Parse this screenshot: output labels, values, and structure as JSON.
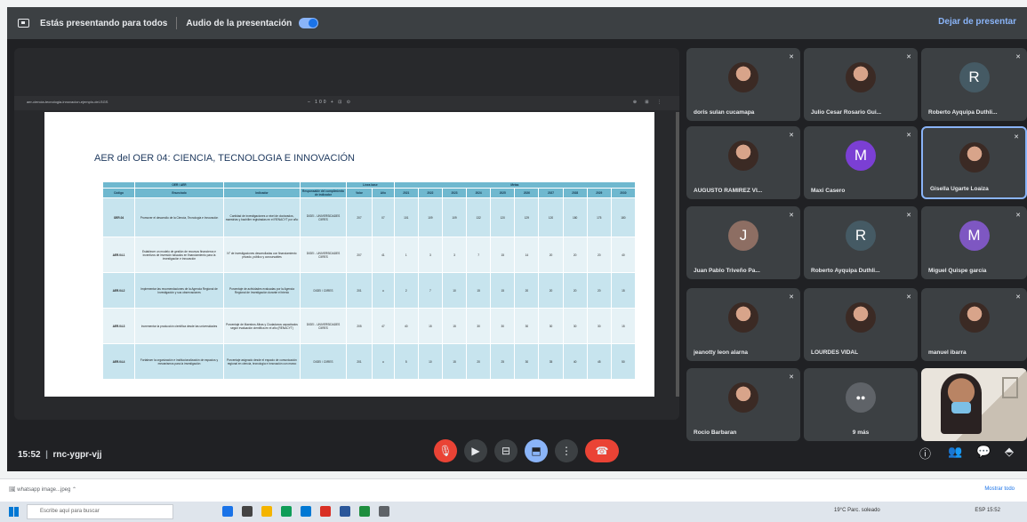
{
  "presentation_bar": {
    "status": "Estás presentando para todos",
    "audio_label": "Audio de la presentación",
    "stop_label": "Dejar de presentar"
  },
  "shared_doc": {
    "file_name": "aer-ciencia-tecnologia-innovacion-ejemplo-del-SGS",
    "zoom_controls": "– 100 + ⊡ ⊙",
    "tools": "⊕ ⊞ ⋮",
    "title": "AER del OER 04: CIENCIA, TECNOLOGIA E INNOVACIÓN",
    "header_group_aer": "OER / AER",
    "header_group_baseline": "Línea base",
    "header_group_goals": "Metas",
    "headers": [
      "Código",
      "Enunciado",
      "Indicador",
      "Responsable del cumplimiento de indicador",
      "Valor",
      "Año",
      "2021",
      "2022",
      "2023",
      "2024",
      "2025",
      "2026",
      "2027",
      "2028",
      "2029",
      "2030"
    ],
    "rows": [
      {
        "code": "OER.04",
        "statement": "Promover el desarrollo de la Ciencia, Tecnología e Innovación",
        "indicator": "Cantidad de investigaciones a nivel de doctorados, maestrías y bachiller registradas en el RENACYT por año",
        "responsible": "DIGEI - UNIVERSIDADES CIIRES",
        "values": [
          "207",
          "07",
          "101",
          "109",
          "109",
          "132",
          "120",
          "129",
          "120",
          "180",
          "175",
          "180"
        ]
      },
      {
        "code": "AER.04.1",
        "statement": "Establecer un modelo de gestión de recursos financieros e incentivos de inversión basados en financiamiento para la investigación e innovación",
        "indicator": "N° de investigaciones desarrolladas con financiamiento privado, público y concursables",
        "responsible": "DIGEI - UNIVERSIDADES CIIRES",
        "values": [
          "207",
          "41",
          "1",
          "3",
          "3",
          "7",
          "15",
          "14",
          "20",
          "20",
          "20",
          "40"
        ]
      },
      {
        "code": "AER.04.2",
        "statement": "Implementar las recomendaciones de la Agencia Regional de Investigación y sus observaciones",
        "indicator": "Porcentaje de actividades evaluadas por la Agencia Regional de Investigación durante el trienio",
        "responsible": "DIGEI / CIIRES",
        "values": [
          "201",
          "u",
          "2",
          "7",
          "10",
          "15",
          "15",
          "20",
          "20",
          "20",
          "20",
          "15"
        ]
      },
      {
        "code": "AER.04.3",
        "statement": "Incrementar la producción científica desde las universidades",
        "indicator": "Porcentaje de Maestros-Miras y Ciudadanos capacitados según evaluación científica en el año (RENACYT)",
        "responsible": "DIGEI - UNIVERSIDADES CIIRES",
        "values": [
          "205",
          "47",
          "40",
          "15",
          "15",
          "30",
          "30",
          "30",
          "30",
          "30",
          "30",
          "15"
        ]
      },
      {
        "code": "AER.04.4",
        "statement": "Fortalecer la organización e institucionalización de espacios y mecanismos para la investigación",
        "indicator": "Porcentaje asignado desde el espacio de comunicación regional en ciencia, tecnología e innovación con marco",
        "responsible": "DIGEI / CIIRES",
        "values": [
          "201",
          "u",
          "5",
          "10",
          "15",
          "20",
          "25",
          "30",
          "35",
          "40",
          "45",
          "50"
        ]
      }
    ]
  },
  "participants": [
    {
      "name": "doris sulan cucamapa",
      "avatar_letter": "",
      "avatar_color": "#7b4a3a"
    },
    {
      "name": "Julio Cesar Rosario Gui...",
      "avatar_letter": "",
      "avatar_color": "#4a7ba6"
    },
    {
      "name": "Roberto Ayquipa Duthli...",
      "avatar_letter": "R",
      "avatar_color": "#455a64"
    },
    {
      "name": "AUGUSTO RAMIREZ VI...",
      "avatar_letter": "",
      "avatar_color": "#6b4f3a"
    },
    {
      "name": "Maxi Casero",
      "avatar_letter": "M",
      "avatar_color": "#7b3fd4"
    },
    {
      "name": "Gisella Ugarte Loaiza",
      "avatar_letter": "",
      "avatar_color": "#b0473b"
    },
    {
      "name": "Juan Pablo Triveño Pa...",
      "avatar_letter": "J",
      "avatar_color": "#8d6e63"
    },
    {
      "name": "Roberto Ayquipa Duthli...",
      "avatar_letter": "R",
      "avatar_color": "#455a64"
    },
    {
      "name": "Miguel Quispe garcia",
      "avatar_letter": "M",
      "avatar_color": "#7e57c2"
    },
    {
      "name": "jeanotty leon alarna",
      "avatar_letter": "",
      "avatar_color": "#c0504d"
    },
    {
      "name": "LOURDES VIDAL",
      "avatar_letter": "",
      "avatar_color": "#d35400"
    },
    {
      "name": "manuel ibarra",
      "avatar_letter": "",
      "avatar_color": "#a04030"
    },
    {
      "name": "Rocio Barbaran",
      "avatar_letter": "",
      "avatar_color": "#5d8aa8"
    }
  ],
  "others_tile": {
    "label": "9 más"
  },
  "meeting": {
    "time": "15:52",
    "code": "rnc-ygpr-vjj"
  },
  "controls": {
    "mic": "🎙",
    "camera": "▶",
    "captions": "⊟",
    "present": "⬒",
    "more": "⋮",
    "leave": "☎"
  },
  "right_controls": {
    "info": "ⓘ",
    "people": "👥",
    "chat": "💬",
    "activities": "⬘"
  },
  "downloads": {
    "file": "whatsapp image...jpeg",
    "show_all": "Mostrar todo"
  },
  "taskbar": {
    "search_placeholder": "Escribe aquí para buscar",
    "weather": "19°C  Parc. soleado",
    "tray": "ESP  15:52"
  },
  "colors": {
    "accent": "#8ab4f8",
    "danger": "#ea4335",
    "table_header": "#6fb8cf",
    "table_band": "#c7e4ee"
  }
}
